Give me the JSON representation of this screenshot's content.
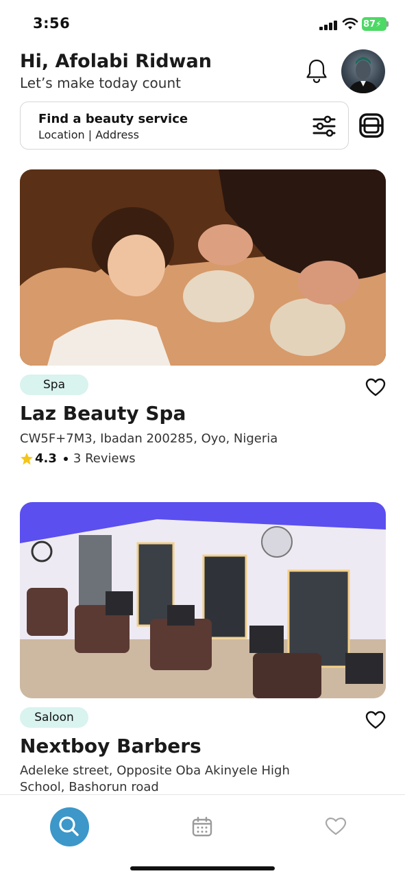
{
  "status": {
    "time": "3:56",
    "battery": "87"
  },
  "header": {
    "greeting": "Hi, Afolabi Ridwan",
    "subtitle": "Let’s make today count"
  },
  "search": {
    "title": "Find a beauty service",
    "subtitle": "Location | Address"
  },
  "listings": [
    {
      "tag": "Spa",
      "name": "Laz Beauty Spa",
      "address": "CW5F+7M3, Ibadan 200285, Oyo, Nigeria",
      "rating": "4.3",
      "reviews": "3 Reviews"
    },
    {
      "tag": "Saloon",
      "name": "Nextboy Barbers",
      "address": "Adeleke street, Opposite Oba Akinyele High School, Bashorun road"
    }
  ],
  "icons": {
    "bell": "bell-icon",
    "filter": "filter-icon",
    "scan": "scan-icon",
    "heart": "heart-icon",
    "star": "star-icon",
    "search": "search-icon",
    "calendar": "calendar-icon"
  },
  "colors": {
    "tag_bg": "#d9f3ef",
    "nav_active": "#3d97c9",
    "star": "#f5c518",
    "battery": "#4cd964"
  }
}
